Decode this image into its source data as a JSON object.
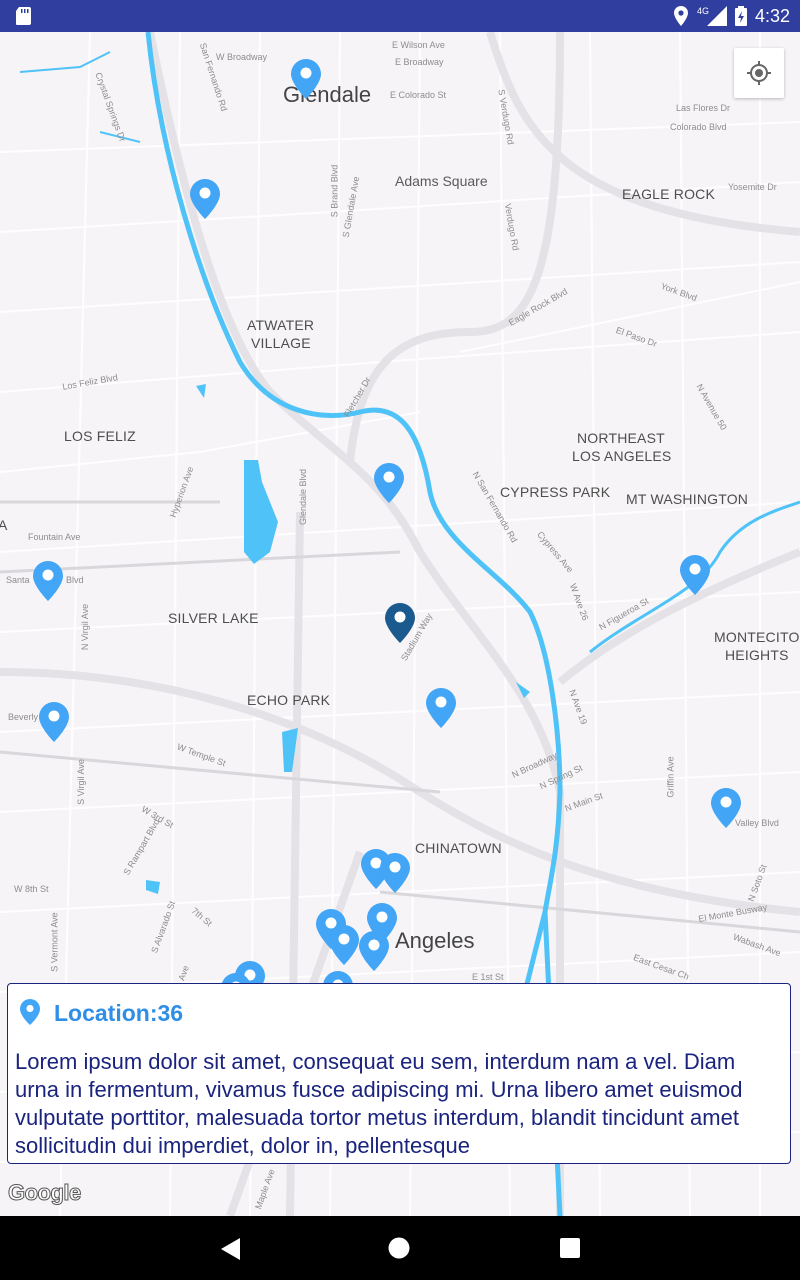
{
  "status_bar": {
    "time": "4:32",
    "network": "4G",
    "icons": [
      "sd-card-icon",
      "location-icon",
      "signal-icon",
      "battery-icon"
    ]
  },
  "map": {
    "city_labels": {
      "glendale": "Glendale",
      "los_angeles": "Angeles"
    },
    "area_labels": {
      "adams_square": "Adams Square",
      "eagle_rock": "EAGLE ROCK",
      "atwater_1": "ATWATER",
      "atwater_2": "VILLAGE",
      "los_feliz": "LOS FELIZ",
      "northeast_1": "NORTHEAST",
      "northeast_2": "LOS ANGELES",
      "cypress_park": "CYPRESS PARK",
      "mt_washington": "MT WASHINGTON",
      "silver_lake": "SILVER LAKE",
      "montecito_1": "MONTECITO",
      "montecito_2": "HEIGHTS",
      "echo_park": "ECHO PARK",
      "chinatown": "CHINATOWN",
      "edge_a": "A"
    },
    "street_labels": {
      "w_wilson": "E Wilson Ave",
      "e_broadway": "E Broadway",
      "w_broadway": "W Broadway",
      "e_colorado": "E Colorado St",
      "s_verdugo": "S Verdugo Rd",
      "s_fernando": "San Fernando Rd",
      "crystal_springs": "Crystal Springs Dr",
      "las_flores": "Las Flores Dr",
      "colorado_blvd": "Colorado Blvd",
      "yosemite": "Yosemite Dr",
      "s_brand": "S Brand Blvd",
      "s_glendale": "S Glendale Ave",
      "verdugo": "Verdugo Rd",
      "york": "York Blvd",
      "eagle_rock_blvd": "Eagle Rock Blvd",
      "el_paso": "El Paso Dr",
      "los_feliz_blvd": "Los Feliz Blvd",
      "fletcher": "Fletcher Dr",
      "n_avenue_50": "N Avenue 50",
      "hyperion": "Hyperion Ave",
      "glendale_blvd": "Glendale Blvd",
      "n_san_fernando": "N San Fernando Rd",
      "cypress_ave": "Cypress Ave",
      "fountain": "Fountain Ave",
      "santa": "Santa",
      "blvd": "Blvd",
      "n_virgil": "N Virgil Ave",
      "w_ave_26": "W Ave 26",
      "n_figueroa": "N Figueroa St",
      "stadium_way": "Stadium Way",
      "beverly": "Beverly",
      "n_ave_19": "N Ave 19",
      "w_temple": "W Temple St",
      "n_broadway": "N Broadway",
      "n_spring": "N Spring St",
      "n_main": "N Main St",
      "s_virgil": "S Virgil Ave",
      "w_3rd": "W 3rd St",
      "s_rampart": "S Rampart Blvd",
      "griffin": "Griffin Ave",
      "valley_blvd": "Valley Blvd",
      "w_8th": "W 8th St",
      "s_alvarado": "S Alvarado St",
      "seventh": "7th St",
      "el_monte": "El Monte Busway",
      "s_soto": "N Soto St",
      "wabash": "Wabash Ave",
      "s_vermont": "S Vermont Ave",
      "e_1st": "E 1st St",
      "e_cesar": "East Cesar Ch",
      "maple": "Maple Ave",
      "ave": "Ave"
    },
    "pin_color": "#42a5f5",
    "selected_pin_color": "#1a5a8e",
    "water_color": "#4fc3f7"
  },
  "info_card": {
    "title": "Location:36",
    "description": "Lorem ipsum dolor sit amet, consequat eu sem, interdum nam a vel. Diam urna in fermentum, vivamus fusce adipiscing mi. Urna libero amet euismod vulputate porttitor, malesuada tortor metus interdum, blandit tincidunt amet sollicitudin dui imperdiet, dolor in, pellentesque"
  },
  "attribution": "Google",
  "nav": [
    "back-icon",
    "home-icon",
    "recents-icon"
  ]
}
